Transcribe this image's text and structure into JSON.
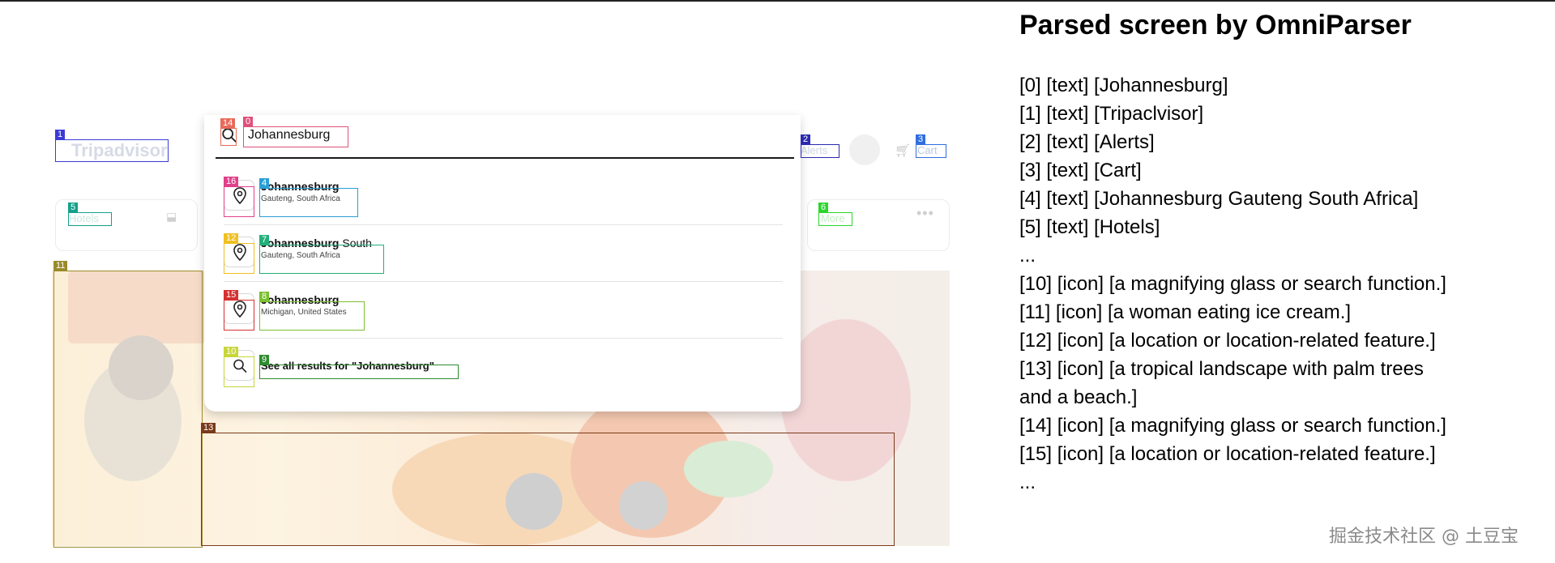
{
  "page": {
    "panel_title": "Parsed screen by OmniParser",
    "watermark": "掘金技术社区 @ 土豆宝"
  },
  "site": {
    "logo_text": "Tripadvisor",
    "nav_alerts": "Alerts",
    "nav_cart": "Cart",
    "hotels_label": "Hotels",
    "more_label": "More"
  },
  "search": {
    "value": "Johannesburg",
    "results": [
      {
        "bold": "Johannesburg",
        "rest": "",
        "subtitle": "Gauteng, South Africa"
      },
      {
        "bold": "Johannesburg",
        "rest": " South",
        "subtitle": "Gauteng, South Africa"
      },
      {
        "bold": "Johannesburg",
        "rest": "",
        "subtitle": "Michigan, United States"
      }
    ],
    "see_all": "See all results for \"Johannesburg\""
  },
  "bbox_tags": {
    "t0": "0",
    "t1": "1",
    "t2": "2",
    "t3": "3",
    "t4": "4",
    "t5": "5",
    "t6": "6",
    "t7": "7",
    "t8": "8",
    "t9": "9",
    "t10": "10",
    "t11": "11",
    "t12": "12",
    "t13": "13",
    "t14": "14",
    "t15": "15",
    "t16": "16"
  },
  "parsed_items": [
    "[0] [text] [Johannesburg]",
    "[1] [text] [Tripaclvisor]",
    "[2] [text] [Alerts]",
    "[3] [text] [Cart]",
    "[4] [text] [Johannesburg Gauteng South Africa]",
    "[5] [text] [Hotels]",
    "...",
    "[10] [icon] [a magnifying glass or search function.]",
    "[11] [icon] [a woman eating ice cream.]",
    "[12] [icon] [a location or location-related feature.]",
    "[13] [icon] [a tropical landscape with palm trees",
    "and a beach.]",
    "[14] [icon] [a magnifying glass or search function.]",
    "[15] [icon] [a location or location-related feature.]",
    "..."
  ],
  "colors": {
    "tag_0": "#e0507a",
    "tag_1": "#3b3bd6",
    "tag_2": "#2a2ab0",
    "tag_3": "#2f6ee0",
    "tag_4": "#2a9fd6",
    "tag_5": "#15a08a",
    "tag_6": "#2bd62b",
    "tag_7": "#22b07a",
    "tag_8": "#7ac030",
    "tag_9": "#2e8b2e",
    "tag_10": "#c8d63a",
    "tag_11": "#9a8a2a",
    "tag_12": "#f0c020",
    "tag_13": "#7a3a1a",
    "tag_14": "#e86a5a",
    "tag_15": "#d63030",
    "tag_16": "#e0408a"
  }
}
